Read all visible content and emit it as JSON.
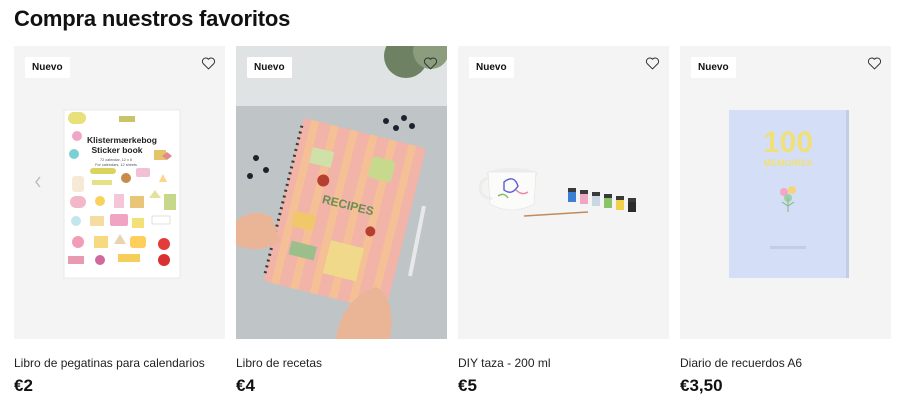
{
  "section": {
    "title": "Compra nuestros favoritos"
  },
  "products": [
    {
      "badge": "Nuevo",
      "name": "Libro de pegatinas para calendarios",
      "price": "€2",
      "cover_title_1": "Klistermærkebog",
      "cover_title_2": "Sticker book",
      "cover_sub_1": "72 calendar, 12 x 6",
      "cover_sub_2": "For calendars, 12 sheets"
    },
    {
      "badge": "Nuevo",
      "name": "Libro de recetas",
      "price": "€4",
      "cover_title": "RECIPES"
    },
    {
      "badge": "Nuevo",
      "name": "DIY taza - 200 ml",
      "price": "€5"
    },
    {
      "badge": "Nuevo",
      "name": "Diario de recuerdos A6",
      "price": "€3,50",
      "cover_number": "100",
      "cover_word": "MEMORIES"
    }
  ],
  "icons": {
    "favorite": "heart-outline-icon",
    "previous": "chevron-left-icon"
  },
  "colors": {
    "text": "#111111",
    "card_bg": "#f4f4f4",
    "badge_bg": "#ffffff"
  }
}
